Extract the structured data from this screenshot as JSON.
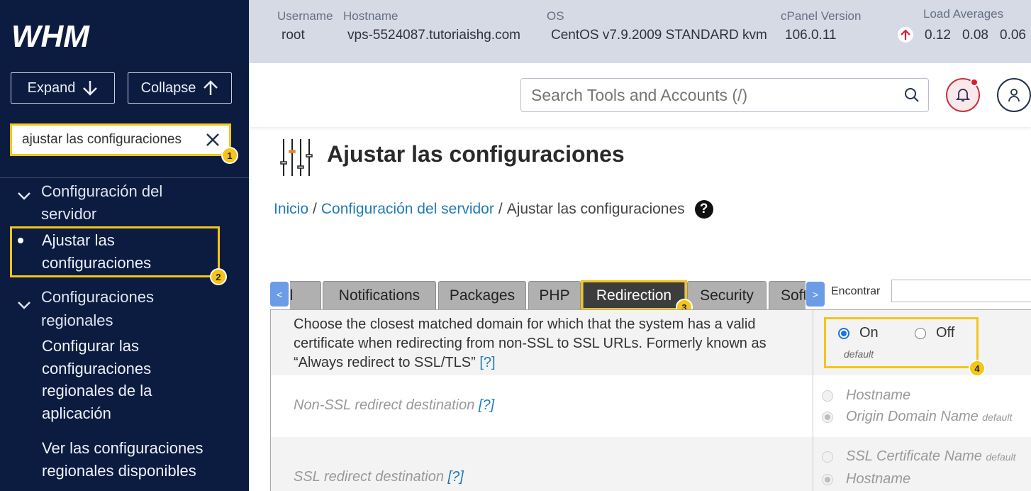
{
  "sidebar": {
    "logo": "WHM",
    "expand_label": "Expand",
    "collapse_label": "Collapse",
    "search_value": "ajustar las configuraciones",
    "groups": [
      {
        "label_line1": "Configuración del",
        "label_line2": "servidor"
      },
      {
        "label_line1": "Configuraciones",
        "label_line2": "regionales"
      }
    ],
    "items": [
      {
        "line1": "Ajustar las",
        "line2": "configuraciones"
      },
      {
        "line1": "Configurar las",
        "line2": "configuraciones",
        "line3": "regionales de la",
        "line4": "aplicación"
      },
      {
        "line1": "Ver las configuraciones",
        "line2": "regionales disponibles"
      }
    ]
  },
  "infobar": {
    "username_label": "Username",
    "username": "root",
    "hostname_label": "Hostname",
    "hostname": "vps-5524087.tutoriaishg.com",
    "os_label": "OS",
    "os": "CentOS v7.9.2009 STANDARD kvm",
    "cpanel_label": "cPanel Version",
    "cpanel": "106.0.11",
    "load_label": "Load Averages",
    "load": [
      "0.12",
      "0.08",
      "0.06"
    ]
  },
  "header": {
    "search_placeholder": "Search Tools and Accounts (/)"
  },
  "page": {
    "title": "Ajustar las configuraciones",
    "breadcrumb": {
      "home": "Inicio",
      "section": "Configuración del servidor",
      "current": "Ajustar las configuraciones",
      "sep": "/"
    }
  },
  "tabs": {
    "prev": "<",
    "next": ">",
    "items": [
      "Mail",
      "Notifications",
      "Packages",
      "PHP",
      "Redirection",
      "Security",
      "Software"
    ],
    "active": "Redirection",
    "find_label": "Encontrar"
  },
  "settings": {
    "row1": {
      "description": "Choose the closest matched domain for which that the system has a valid certificate when redirecting from non-SSL to SSL URLs. Formerly known as “Always redirect to SSL/TLS”",
      "help": "[?]",
      "on": "On",
      "off": "Off",
      "default": "default"
    },
    "row2": {
      "label": "Non-SSL redirect destination",
      "help": "[?]",
      "opt1": "Hostname",
      "opt2": "Origin Domain Name",
      "default": "default"
    },
    "row3": {
      "label": "SSL redirect destination",
      "help": "[?]",
      "opt1": "SSL Certificate Name",
      "opt2": "Hostname",
      "default": "default"
    }
  },
  "badges": [
    "1",
    "2",
    "3",
    "4"
  ],
  "colors": {
    "sidebar": "#0c1b40",
    "highlight": "#f5c518",
    "link": "#1f7bb6",
    "active_tab": "#3d3d3d"
  }
}
